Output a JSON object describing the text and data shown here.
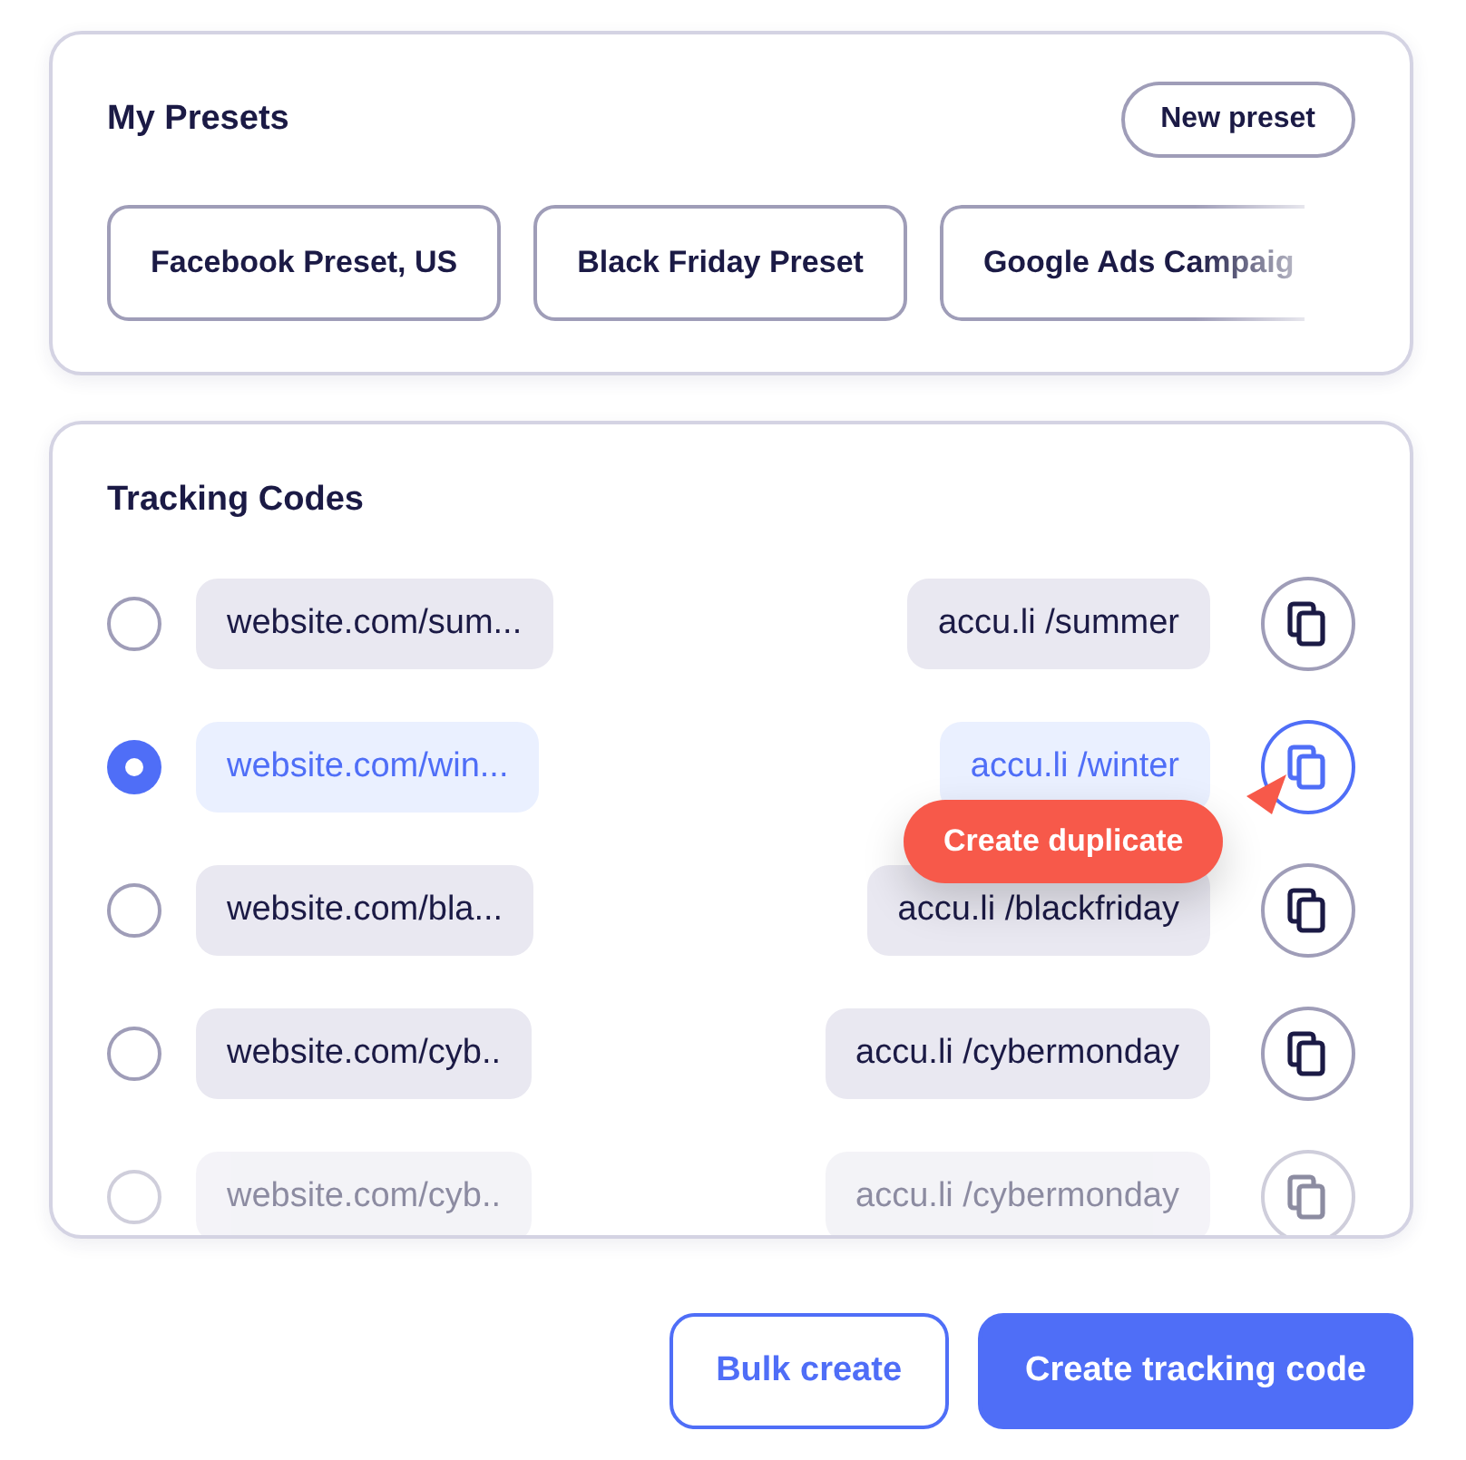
{
  "presets": {
    "title": "My Presets",
    "new_button": "New preset",
    "items": [
      {
        "label": "Facebook Preset, US",
        "cut": false
      },
      {
        "label": "Black Friday Preset",
        "cut": false
      },
      {
        "label": "Google Ads Campaig",
        "cut": true
      }
    ]
  },
  "tracking_codes": {
    "title": "Tracking Codes",
    "rows": [
      {
        "url": "website.com/sum...",
        "short_link": "accu.li /summer",
        "selected": false,
        "faded": false
      },
      {
        "url": "website.com/win...",
        "short_link": "accu.li /winter",
        "selected": true,
        "faded": false,
        "tooltip": "Create duplicate"
      },
      {
        "url": "website.com/bla...",
        "short_link": "accu.li /blackfriday",
        "selected": false,
        "faded": false
      },
      {
        "url": "website.com/cyb..",
        "short_link": "accu.li /cybermonday",
        "selected": false,
        "faded": false
      },
      {
        "url": "website.com/cyb..",
        "short_link": "accu.li /cybermonday",
        "selected": false,
        "faded": true
      }
    ]
  },
  "actions": [
    {
      "label": "Bulk create",
      "kind": "secondary"
    },
    {
      "label": "Create tracking code",
      "kind": "primary"
    }
  ]
}
